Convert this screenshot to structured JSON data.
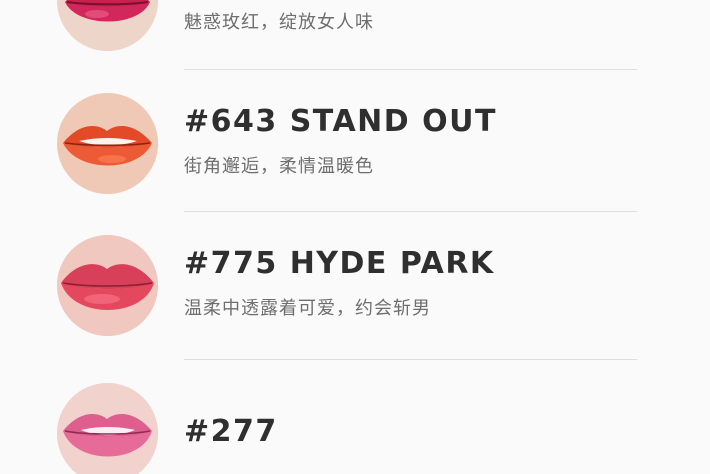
{
  "products": [
    {
      "code": "",
      "description": "魅惑玫红，绽放女人味",
      "swatch_color": "#d2275a",
      "swatch_icon": "lips-icon"
    },
    {
      "code": "#643 STAND OUT",
      "description": "街角邂逅，柔情温暖色",
      "swatch_color": "#ec5a36",
      "swatch_icon": "lips-icon"
    },
    {
      "code": "#775 HYDE PARK",
      "description": "温柔中透露着可爱，约会斩男",
      "swatch_color": "#e3485f",
      "swatch_icon": "lips-icon"
    },
    {
      "code": "#277",
      "description": "",
      "swatch_color": "#e66b98",
      "swatch_icon": "lips-icon"
    }
  ],
  "colors": {
    "background": "#fafafa",
    "title": "#2f2f2f",
    "subtitle": "#6e6e6e",
    "divider": "#dedede"
  }
}
